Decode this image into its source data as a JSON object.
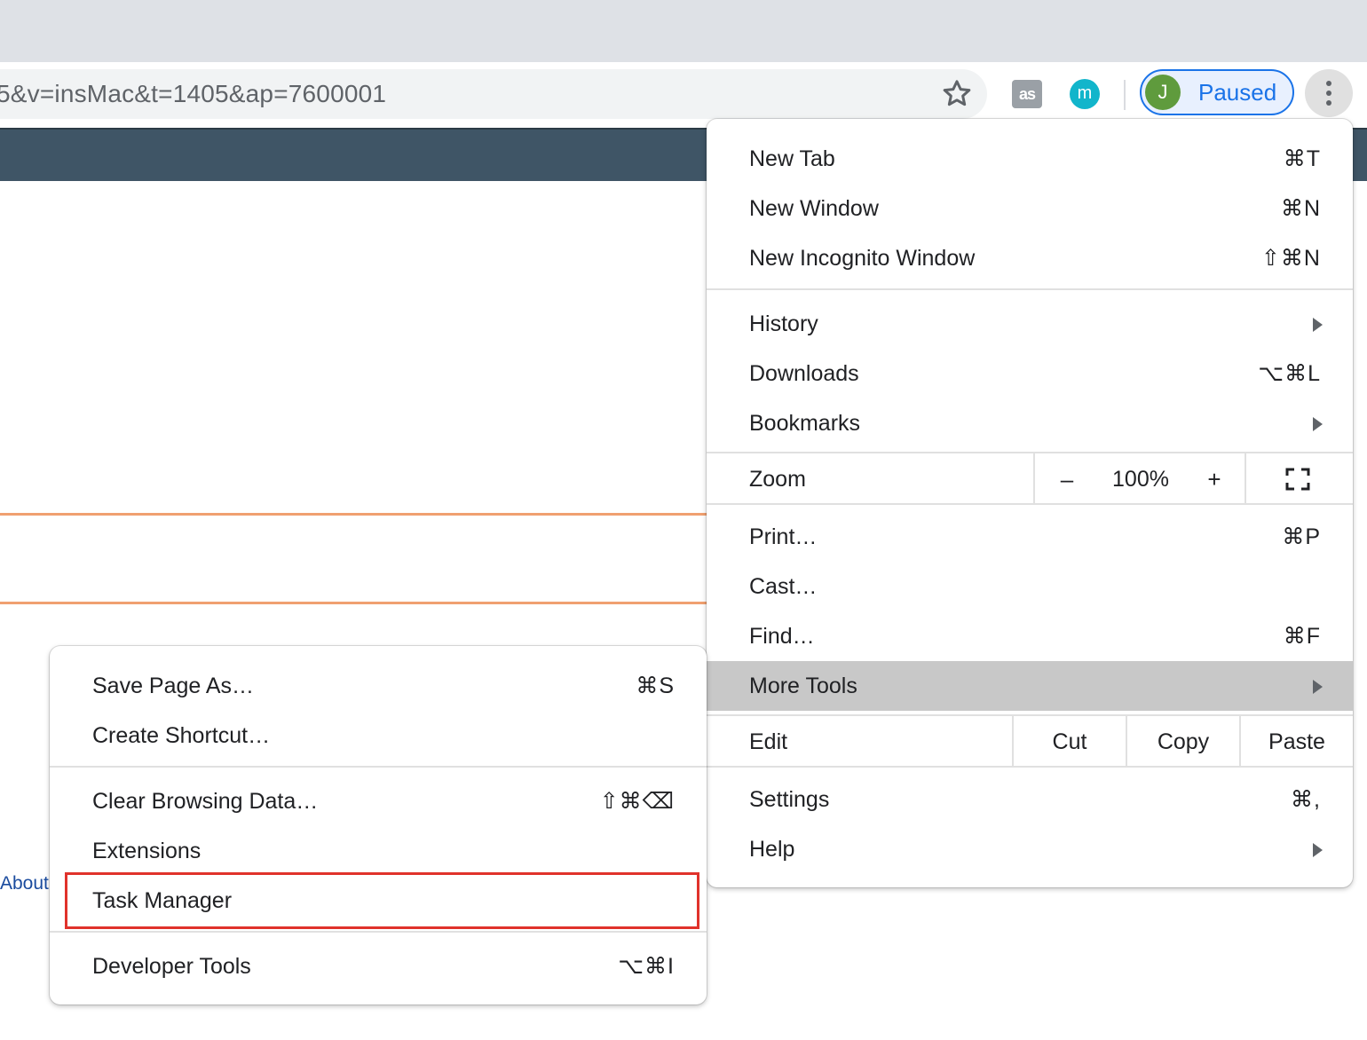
{
  "browser": {
    "url_text": "5&v=insMac&t=1405&ap=7600001",
    "extension_lastfm_glyph": "as",
    "extension_m_glyph": "m",
    "profile": {
      "initial": "J",
      "status": "Paused"
    },
    "colors": {
      "tabstrip": "#dee1e6",
      "profile_accent": "#1a73e8",
      "avatar": "#5f9b3d"
    }
  },
  "page": {
    "header_color": "#3f5566",
    "about_link": "About"
  },
  "main_menu": {
    "new_tab": {
      "label": "New Tab",
      "shortcut": "⌘T"
    },
    "new_window": {
      "label": "New Window",
      "shortcut": "⌘N"
    },
    "new_incognito": {
      "label": "New Incognito Window",
      "shortcut": "⇧⌘N"
    },
    "history": {
      "label": "History"
    },
    "downloads": {
      "label": "Downloads",
      "shortcut": "⌥⌘L"
    },
    "bookmarks": {
      "label": "Bookmarks"
    },
    "zoom": {
      "label": "Zoom",
      "minus": "–",
      "value": "100%",
      "plus": "+"
    },
    "print": {
      "label": "Print…",
      "shortcut": "⌘P"
    },
    "cast": {
      "label": "Cast…"
    },
    "find": {
      "label": "Find…",
      "shortcut": "⌘F"
    },
    "more_tools": {
      "label": "More Tools",
      "highlighted": true
    },
    "edit": {
      "label": "Edit",
      "cut": "Cut",
      "copy": "Copy",
      "paste": "Paste"
    },
    "settings": {
      "label": "Settings",
      "shortcut": "⌘,"
    },
    "help": {
      "label": "Help"
    }
  },
  "more_tools_menu": {
    "save_page": {
      "label": "Save Page As…",
      "shortcut": "⌘S"
    },
    "create_shortcut": {
      "label": "Create Shortcut…"
    },
    "clear_browsing": {
      "label": "Clear Browsing Data…",
      "shortcut": "⇧⌘⌫"
    },
    "extensions": {
      "label": "Extensions"
    },
    "task_manager": {
      "label": "Task Manager",
      "annotated": true
    },
    "developer_tools": {
      "label": "Developer Tools",
      "shortcut": "⌥⌘I"
    }
  },
  "annotation": {
    "color": "#e0322b"
  }
}
